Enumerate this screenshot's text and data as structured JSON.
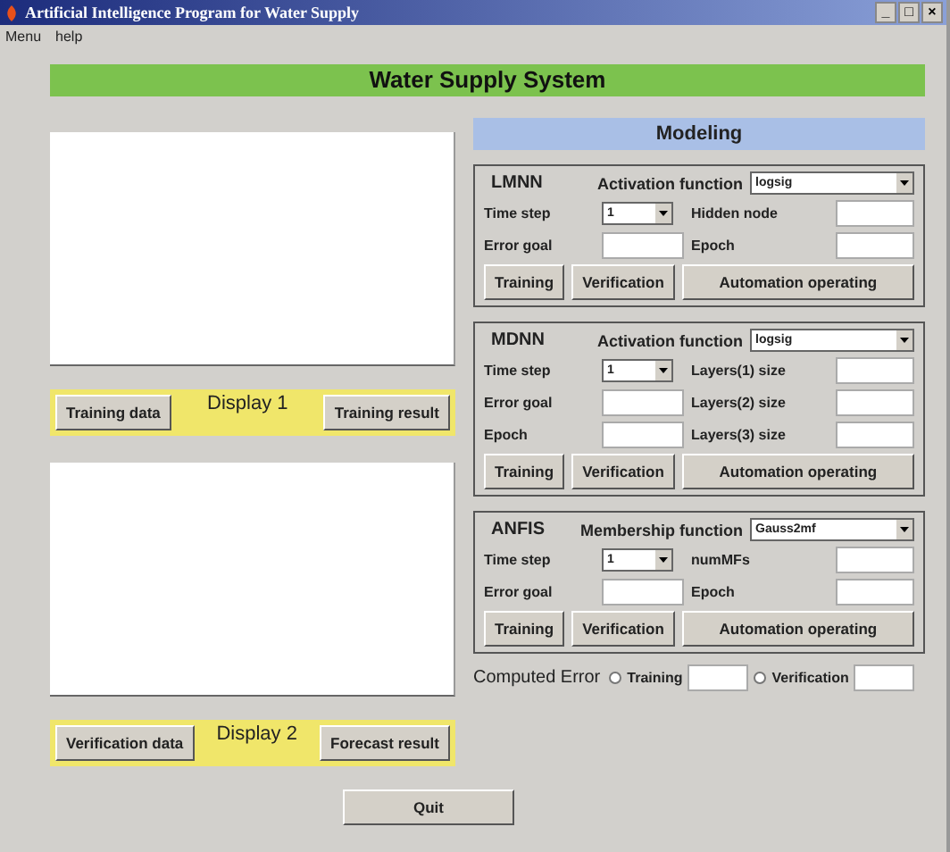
{
  "window": {
    "title": "Artificial Intelligence Program for Water Supply",
    "controls": [
      "_",
      "□",
      "×"
    ]
  },
  "menu": [
    "Menu",
    "help"
  ],
  "banner": "Water Supply System",
  "displays": [
    {
      "label": "Display 1",
      "buttons": [
        "Training data",
        "Training result"
      ]
    },
    {
      "label": "Display 2",
      "buttons": [
        "Verification data",
        "Forecast result"
      ]
    }
  ],
  "modeling": {
    "title": "Modeling",
    "panels": [
      {
        "name": "LMNN",
        "function_label": "Activation function",
        "function_value": "logsig",
        "fields": [
          {
            "label": "Time step",
            "kind": "select",
            "value": "1"
          },
          {
            "label": "Hidden node",
            "kind": "input"
          },
          {
            "label": "Error goal",
            "kind": "input"
          },
          {
            "label": "Epoch",
            "kind": "input"
          }
        ],
        "buttons": [
          "Training",
          "Verification",
          "Automation operating"
        ]
      },
      {
        "name": "MDNN",
        "function_label": "Activation function",
        "function_value": "logsig",
        "fields": [
          {
            "label": "Time step",
            "kind": "select",
            "value": "1"
          },
          {
            "label": "Layers(1) size",
            "kind": "input"
          },
          {
            "label": "Error goal",
            "kind": "input"
          },
          {
            "label": "Layers(2) size",
            "kind": "input"
          },
          {
            "label": "Epoch",
            "kind": "input"
          },
          {
            "label": "Layers(3) size",
            "kind": "input"
          }
        ],
        "buttons": [
          "Training",
          "Verification",
          "Automation operating"
        ]
      },
      {
        "name": "ANFIS",
        "function_label": "Membership function",
        "function_value": "Gauss2mf",
        "fields": [
          {
            "label": "Time step",
            "kind": "select",
            "value": "1"
          },
          {
            "label": "numMFs",
            "kind": "input"
          },
          {
            "label": "Error goal",
            "kind": "input"
          },
          {
            "label": "Epoch",
            "kind": "input"
          }
        ],
        "buttons": [
          "Training",
          "Verification",
          "Automation operating"
        ]
      }
    ]
  },
  "computed_error": {
    "label": "Computed Error",
    "options": [
      {
        "label": "Training",
        "selected": false
      },
      {
        "label": "Verification",
        "selected": false
      }
    ]
  },
  "quit": "Quit"
}
